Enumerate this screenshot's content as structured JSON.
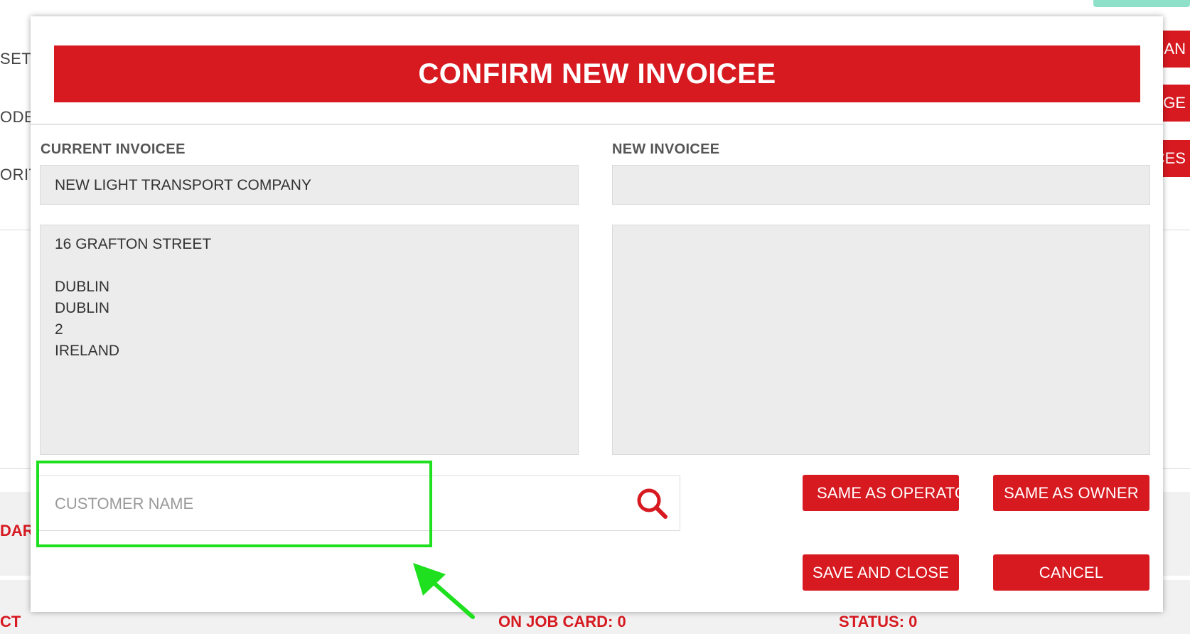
{
  "background": {
    "left_labels": [
      "SET",
      "ODE",
      "ORIT"
    ],
    "right_buttons": [
      "CAN",
      "GE",
      "CES"
    ],
    "bottom_left_red": "DAR",
    "footer_left": "CT",
    "footer_on_job_card": "ON JOB CARD: 0",
    "footer_status": "STATUS: 0"
  },
  "modal": {
    "title": "CONFIRM NEW INVOICEE",
    "current": {
      "label": "CURRENT INVOICEE",
      "name": "NEW LIGHT TRANSPORT COMPANY",
      "address": "16 GRAFTON STREET\n\nDUBLIN\nDUBLIN\n2\nIRELAND"
    },
    "new": {
      "label": "NEW INVOICEE",
      "name": "",
      "address": ""
    },
    "search": {
      "placeholder": "CUSTOMER NAME",
      "value": ""
    },
    "buttons": {
      "same_as_operator": "SAME AS OPERATOR",
      "same_as_owner": "SAME AS OWNER",
      "save_and_close": "SAVE AND CLOSE",
      "cancel": "CANCEL"
    }
  },
  "colors": {
    "brand_red": "#d71920",
    "highlight_green": "#1ee01e"
  }
}
